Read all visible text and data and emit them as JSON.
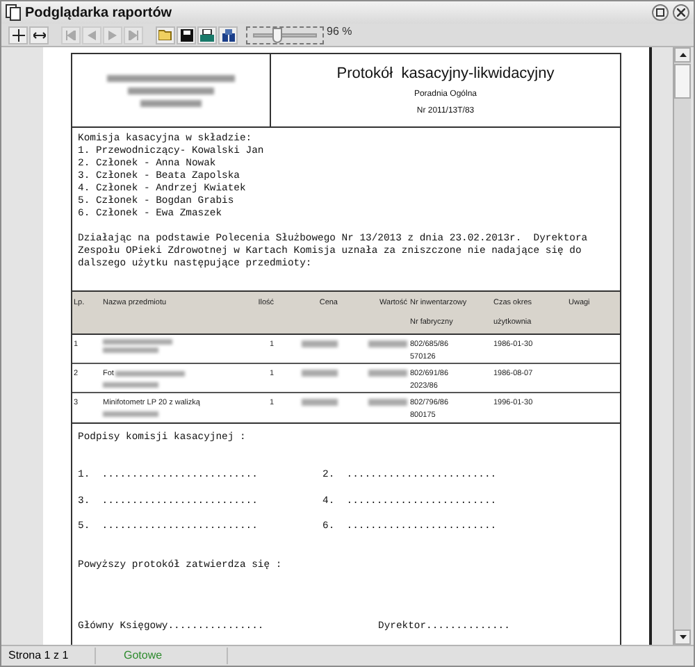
{
  "window": {
    "title": "Podglądarka raportów"
  },
  "zoom": {
    "level": 0.37,
    "reading": "96 %"
  },
  "report": {
    "title": "Protokół  kasacyjny-likwidacyjny",
    "unit": "Poradnia Ogólna",
    "number": "Nr 2011/13T/83",
    "committee": [
      "Komisja kasacyjna w składzie:",
      "1. Przewodniczący- Kowalski Jan",
      "2. Członek - Anna Nowak",
      "3. Członek - Beata Zapolska",
      "4. Członek - Andrzej Kwiatek",
      "5. Członek - Bogdan Grabis",
      "6. Członek - Ewa Zmaszek"
    ],
    "paragraph": "Działając na podstawie Polecenia Służbowego Nr 13/2013 z dnia 23.02.2013r.  Dyrektora Zespołu OPieki Zdrowotnej w Kartach Komisja uznała za zniszczone nie nadające się do dalszego użytku następujące przedmioty:",
    "columns": [
      {
        "lines": [
          "Lp."
        ]
      },
      {
        "lines": [
          "Nazwa przedmiotu"
        ]
      },
      {
        "lines": [
          "Ilość"
        ]
      },
      {
        "lines": [
          "Cena"
        ]
      },
      {
        "lines": [
          "Wartość"
        ]
      },
      {
        "lines": [
          "Nr inwentarzowy",
          "Nr fabryczny"
        ]
      },
      {
        "lines": [
          "Czas okres",
          "użytkownia"
        ]
      },
      {
        "lines": [
          "Uwagi"
        ]
      }
    ],
    "rows": [
      {
        "lp": "1",
        "name": "",
        "qty": "1",
        "inventory": [
          "802/685/86",
          "570126"
        ],
        "date": "1986-01-30"
      },
      {
        "lp": "2",
        "name": "Fot",
        "qty": "1",
        "inventory": [
          "802/691/86",
          "2023/86"
        ],
        "date": "1986-08-07"
      },
      {
        "lp": "3",
        "name": "Minifotometr LP 20 z walizką",
        "qty": "1",
        "inventory": [
          "802/796/86",
          "800175"
        ],
        "date": "1996-01-30"
      }
    ],
    "signatures_title": "Podpisy komisji kasacyjnej :",
    "signature_slots": [
      "1.  ..........................",
      "2.  .........................",
      "3.  ..........................",
      "4.  .........................",
      "5.  ..........................",
      "6.  ........................."
    ],
    "approval": "Powyższy protokół zatwierdza się :",
    "accountant": "Główny Księgowy................",
    "director": "Dyrektor.............."
  },
  "status_bar": {
    "page": "Strona 1 z 1",
    "state": "Gotowe"
  }
}
